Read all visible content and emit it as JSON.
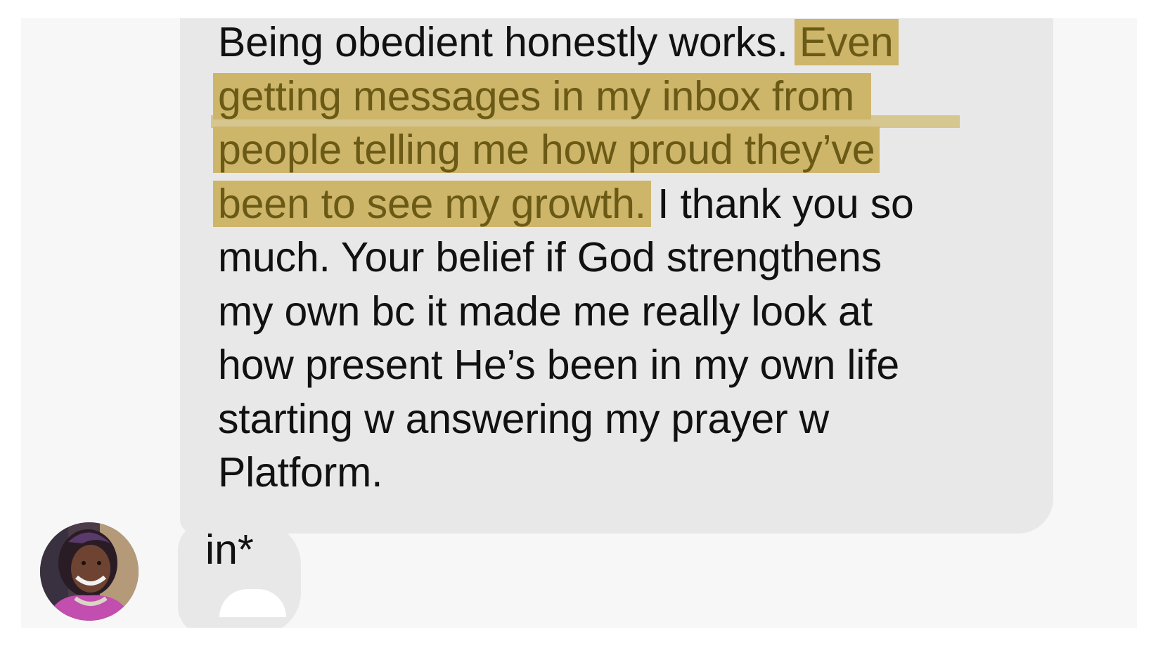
{
  "conversation": {
    "message_1": {
      "line_1_plain": "Being obedient honestly works. ",
      "line_1_highlight": "Even",
      "line_2_highlight": "getting messages in my inbox from",
      "line_3_highlight": "people telling me how proud they’ve",
      "line_4_highlight": "been to see my growth.",
      "line_4_plain": " I thank you so",
      "line_5": "much. Your belief if God strengthens",
      "line_6": "my own bc it made me really look at",
      "line_7": "how present He’s been in my own life",
      "line_8": "starting w answering my prayer w",
      "line_9": "Platform."
    },
    "message_2": {
      "text": "in*"
    },
    "sender": {
      "avatar_icon": "profile-photo-avatar"
    }
  },
  "colors": {
    "bubble": "#e8e8e8",
    "highlight": "#cdb56a",
    "highlight_text": "#6a5a16",
    "text": "#111111"
  }
}
